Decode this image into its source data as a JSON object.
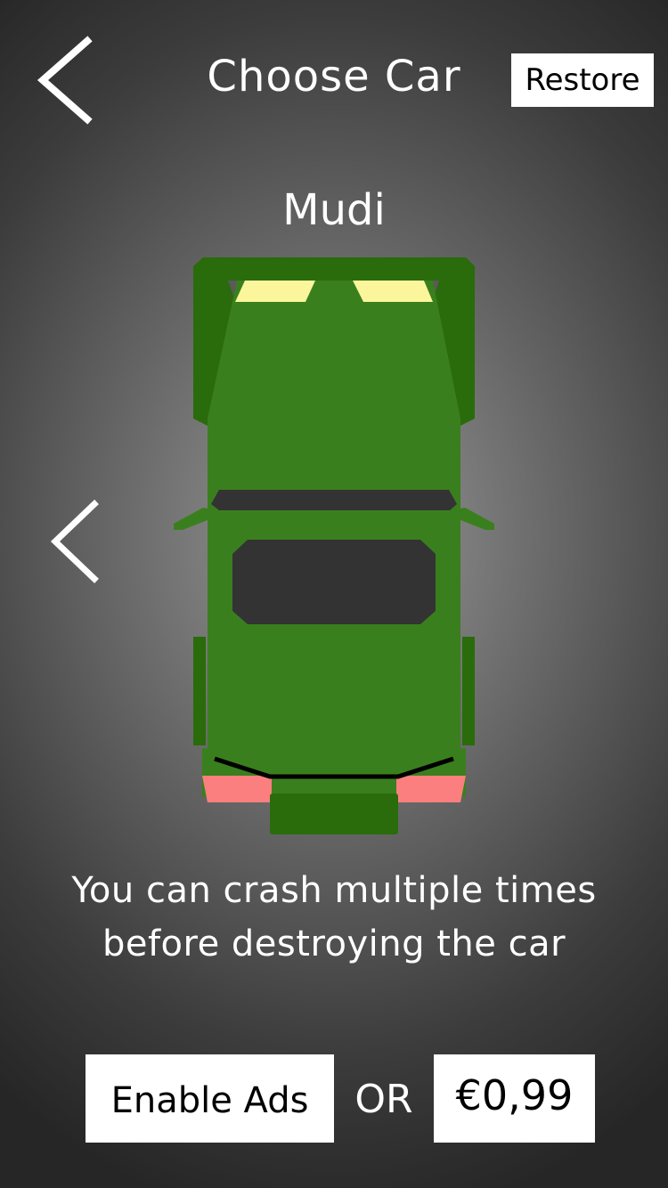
{
  "header": {
    "title": "Choose Car",
    "restore_label": "Restore",
    "back_icon": "chevron-left-icon"
  },
  "car": {
    "name": "Mudi",
    "body_color": "#3a7f1d",
    "dark_color": "#2a6b0c",
    "headlight_color": "#fbf59b",
    "taillight_color": "#fb7f7f",
    "glass_color": "#333333",
    "description_line1": "You can crash multiple times",
    "description_line2": "before destroying the car"
  },
  "navigation": {
    "previous_icon": "chevron-left-icon"
  },
  "purchase": {
    "ads_label": "Enable Ads",
    "or_label": "OR",
    "price_label": "€0,99"
  }
}
